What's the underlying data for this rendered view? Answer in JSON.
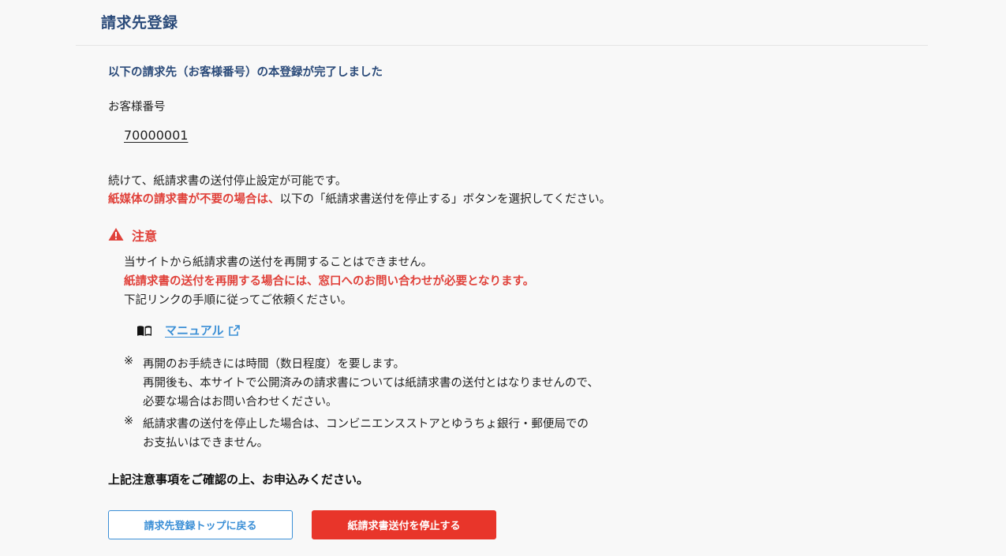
{
  "header": {
    "title": "請求先登録"
  },
  "main": {
    "heading": "以下の請求先（お客様番号）の本登録が完了しました",
    "customer_number_label": "お客様番号",
    "customer_number": "70000001",
    "para1": "続けて、紙請求書の送付停止設定が可能です。",
    "para2_red": "紙媒体の請求書が不要の場合は、",
    "para2_rest": "以下の「紙請求書送付を停止する」ボタンを選択してください。"
  },
  "notice": {
    "title": "注意",
    "line1": "当サイトから紙請求書の送付を再開することはできません。",
    "line2": "紙請求書の送付を再開する場合には、窓口へのお問い合わせが必要となります。",
    "line3": "下記リンクの手順に従ってご依頼ください。",
    "manual_link": "マニュアル",
    "note_mark": "※",
    "note1_line1": "再開のお手続きには時間（数日程度）を要します。",
    "note1_line2": "再開後も、本サイトで公開済みの請求書については紙請求書の送付とはなりませんので、",
    "note1_line3": "必要な場合はお問い合わせください。",
    "note2_line1": "紙請求書の送付を停止した場合は、コンビニエンスストアとゆうちょ銀行・郵便局での",
    "note2_line2": "お支払いはできません。"
  },
  "confirm_text": "上記注意事項をご確認の上、お申込みください。",
  "buttons": {
    "back_label": "請求先登録トップに戻る",
    "stop_label": "紙請求書送付を停止する"
  },
  "colors": {
    "title": "#2b4b7a",
    "accent_red": "#e0413a",
    "link_blue": "#3b8fd6",
    "button_red": "#e8352a"
  },
  "icons": {
    "warning": "warning-triangle-icon",
    "manual": "book-icon",
    "external": "external-link-icon"
  }
}
